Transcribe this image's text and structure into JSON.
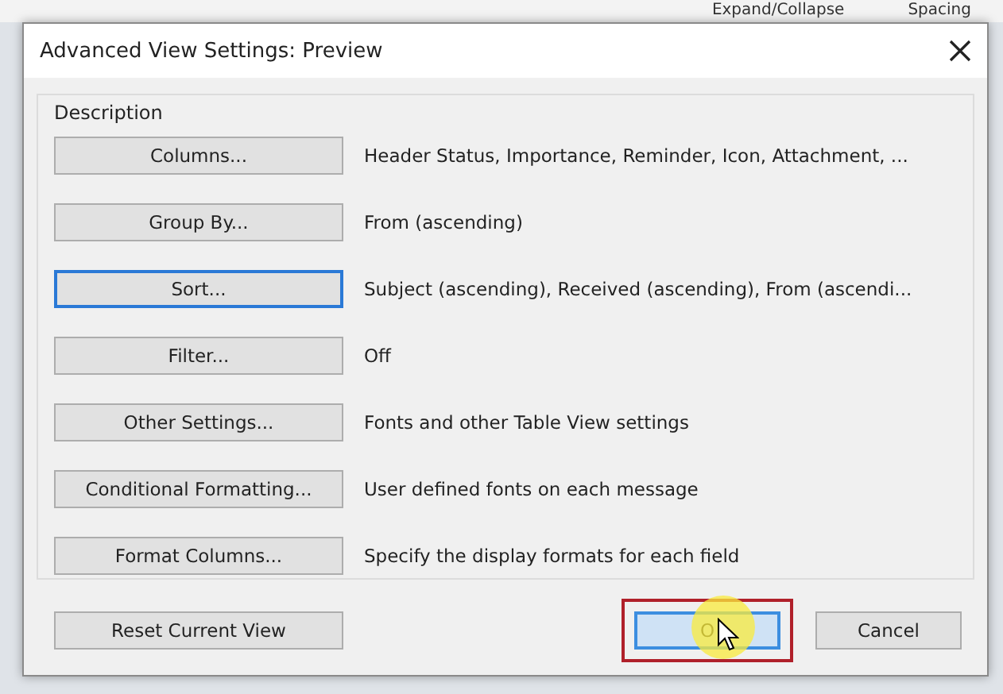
{
  "background_ribbon": {
    "items": [
      "Expand/Collapse",
      "Spacing"
    ]
  },
  "dialog": {
    "title": "Advanced View Settings: Preview",
    "group_label": "Description",
    "rows": [
      {
        "button": "Columns...",
        "focused": false,
        "description": "Header Status, Importance, Reminder, Icon, Attachment, ..."
      },
      {
        "button": "Group By...",
        "focused": false,
        "description": "From (ascending)"
      },
      {
        "button": "Sort...",
        "focused": true,
        "description": "Subject (ascending), Received (ascending), From (ascendi..."
      },
      {
        "button": "Filter...",
        "focused": false,
        "description": "Off"
      },
      {
        "button": "Other Settings...",
        "focused": false,
        "description": "Fonts and other Table View settings"
      },
      {
        "button": "Conditional Formatting...",
        "focused": false,
        "description": "User defined fonts on each message"
      },
      {
        "button": "Format Columns...",
        "focused": false,
        "description": "Specify the display formats for each field"
      }
    ],
    "reset_button": "Reset Current View",
    "buttons": [
      {
        "label": "O",
        "default": true,
        "highlighted": true
      },
      {
        "label": "Cancel",
        "default": false,
        "highlighted": false
      }
    ]
  }
}
